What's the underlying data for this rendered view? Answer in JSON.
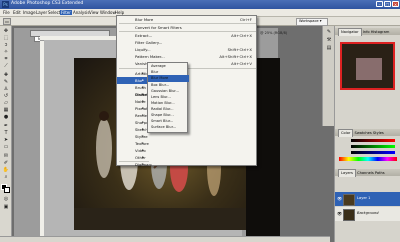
{
  "window": {
    "title": "Adobe Photoshop CS3 Extended"
  },
  "menubar": [
    "File",
    "Edit",
    "Image",
    "Layer",
    "Select",
    "Filter",
    "Analysis",
    "View",
    "Window",
    "Help"
  ],
  "options_bar": {
    "workspace_label": "Workspace ▾"
  },
  "document": {
    "tab_label": "NEW_Pictu...",
    "info_label": "@ 25% (RGB/8)"
  },
  "filter_menu": {
    "items": [
      {
        "label": "Blur More",
        "shortcut": "Ctrl+F"
      },
      {
        "sep": true
      },
      {
        "label": "Convert for Smart Filters"
      },
      {
        "sep": true
      },
      {
        "label": "Extract...",
        "shortcut": "Alt+Ctrl+X"
      },
      {
        "label": "Filter Gallery..."
      },
      {
        "label": "Liquify...",
        "shortcut": "Shift+Ctrl+X"
      },
      {
        "label": "Pattern Maker...",
        "shortcut": "Alt+Shift+Ctrl+X"
      },
      {
        "label": "Vanishing Point...",
        "shortcut": "Alt+Ctrl+V"
      },
      {
        "sep": true
      },
      {
        "label": "Artistic",
        "submenu": true
      },
      {
        "label": "Blur",
        "submenu": true,
        "highlight": true
      },
      {
        "label": "Brush Strokes",
        "submenu": true
      },
      {
        "label": "Distort",
        "submenu": true
      },
      {
        "label": "Noise",
        "submenu": true
      },
      {
        "label": "Pixelate",
        "submenu": true
      },
      {
        "label": "Render",
        "submenu": true
      },
      {
        "label": "Sharpen",
        "submenu": true
      },
      {
        "label": "Sketch",
        "submenu": true
      },
      {
        "label": "Stylize",
        "submenu": true
      },
      {
        "label": "Texture",
        "submenu": true
      },
      {
        "label": "Video",
        "submenu": true
      },
      {
        "label": "Other",
        "submenu": true
      },
      {
        "sep": true
      },
      {
        "label": "Digimarc",
        "submenu": true
      }
    ]
  },
  "blur_menu": {
    "items": [
      {
        "label": "Average"
      },
      {
        "label": "Blur"
      },
      {
        "label": "Blur More",
        "highlight": true
      },
      {
        "label": "Box Blur..."
      },
      {
        "label": "Gaussian Blur..."
      },
      {
        "label": "Lens Blur..."
      },
      {
        "label": "Motion Blur..."
      },
      {
        "label": "Radial Blur..."
      },
      {
        "label": "Shape Blur..."
      },
      {
        "label": "Smart Blur..."
      },
      {
        "label": "Surface Blur..."
      }
    ]
  },
  "panels": {
    "navigator_tabs": [
      "Navigator",
      "Info",
      "Histogram"
    ],
    "color_tabs": [
      "Color",
      "Swatches",
      "Styles"
    ],
    "layers_tabs": [
      "Layers",
      "Channels",
      "Paths"
    ],
    "layers": [
      {
        "name": "Layer 1",
        "selected": true
      },
      {
        "name": "Background",
        "selected": false
      }
    ]
  },
  "colors": {
    "title_blue": "#2f54a0",
    "highlight": "#2f62b5",
    "nav_frame": "#dd2222"
  }
}
